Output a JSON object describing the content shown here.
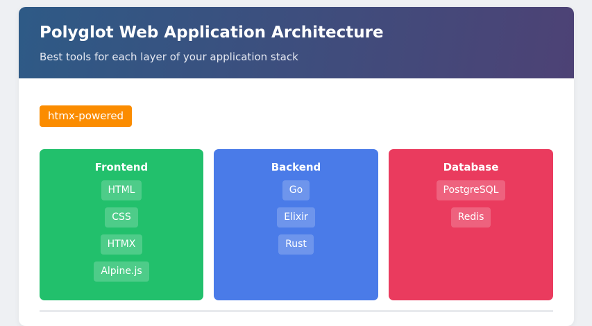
{
  "header": {
    "title": "Polyglot Web Application Architecture",
    "subtitle": "Best tools for each layer of your application stack"
  },
  "badge": {
    "label": "htmx-powered",
    "color": "#fb8c00"
  },
  "layers": [
    {
      "title": "Frontend",
      "color": "#22c06c",
      "tools": [
        "HTML",
        "CSS",
        "HTMX",
        "Alpine.js"
      ]
    },
    {
      "title": "Backend",
      "color": "#4a7be8",
      "tools": [
        "Go",
        "Elixir",
        "Rust"
      ]
    },
    {
      "title": "Database",
      "color": "#ea3b5e",
      "tools": [
        "PostgreSQL",
        "Redis"
      ]
    }
  ],
  "colors": {
    "header_gradient_start": "#2e5a86",
    "header_gradient_end": "#4d4275"
  }
}
